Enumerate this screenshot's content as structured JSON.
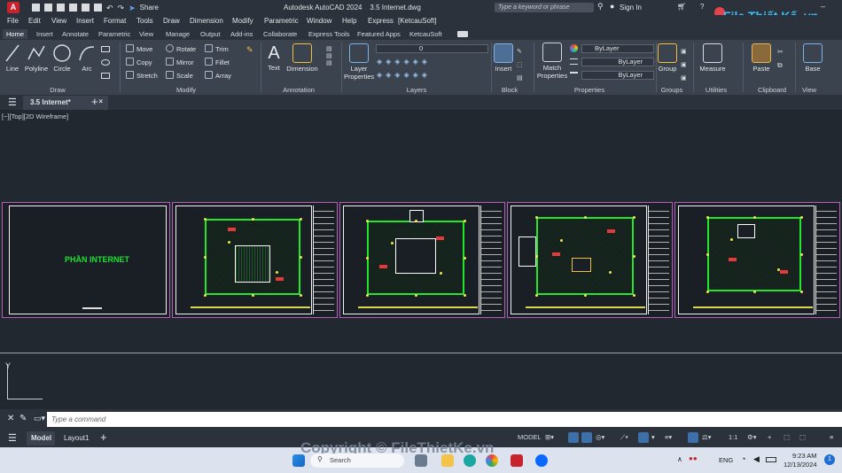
{
  "app": {
    "title": "Autodesk AutoCAD 2024",
    "file": "3.5 Internet.dwg",
    "logo": "A"
  },
  "quick_access": {
    "share": "Share"
  },
  "search": {
    "placeholder": "Type a keyword or phrase"
  },
  "user": {
    "sign_in": "Sign In"
  },
  "watermark": {
    "logo": "File Thiết Kế .vn",
    "copyright": "Copyright © FileThietKe.vn"
  },
  "menu": [
    "File",
    "Edit",
    "View",
    "Insert",
    "Format",
    "Tools",
    "Draw",
    "Dimension",
    "Modify",
    "Parametric",
    "Window",
    "Help",
    "Express",
    "[KetcauSoft]"
  ],
  "ribbon_tabs": [
    "Home",
    "Insert",
    "Annotate",
    "Parametric",
    "View",
    "Manage",
    "Output",
    "Add-ins",
    "Collaborate",
    "Express Tools",
    "Featured Apps",
    "KetcauSoft"
  ],
  "ribbon": {
    "draw": {
      "label": "Draw",
      "line": "Line",
      "polyline": "Polyline",
      "circle": "Circle",
      "arc": "Arc"
    },
    "modify": {
      "label": "Modify",
      "move": "Move",
      "rotate": "Rotate",
      "trim": "Trim",
      "copy": "Copy",
      "mirror": "Mirror",
      "fillet": "Fillet",
      "stretch": "Stretch",
      "scale": "Scale",
      "array": "Array"
    },
    "annotation": {
      "label": "Annotation",
      "text": "Text",
      "dimension": "Dimension"
    },
    "layers": {
      "label": "Layers",
      "layer_properties": "Layer Properties",
      "current_layer": "0"
    },
    "block": {
      "label": "Block",
      "insert": "Insert"
    },
    "properties": {
      "label": "Properties",
      "match": "Match Properties",
      "color": "ByLayer",
      "linetype": "ByLayer",
      "lineweight": "ByLayer"
    },
    "groups": {
      "label": "Groups",
      "group": "Group"
    },
    "utilities": {
      "label": "Utilities",
      "measure": "Measure"
    },
    "clipboard": {
      "label": "Clipboard",
      "paste": "Paste"
    },
    "view": {
      "label": "View",
      "base": "Base"
    }
  },
  "doc_tabs": {
    "active": "3.5 Internet*"
  },
  "viewport": {
    "label": "[−][Top][2D Wireframe]"
  },
  "drawing": {
    "cover_title": "PHẦN INTERNET"
  },
  "command": {
    "placeholder": "Type a command"
  },
  "layouts": {
    "model": "Model",
    "layout1": "Layout1"
  },
  "status": {
    "model": "MODEL",
    "scale": "1:1"
  },
  "taskbar": {
    "search": "Search",
    "lang": "ENG",
    "time": "9:23 AM",
    "date": "12/13/2024"
  }
}
